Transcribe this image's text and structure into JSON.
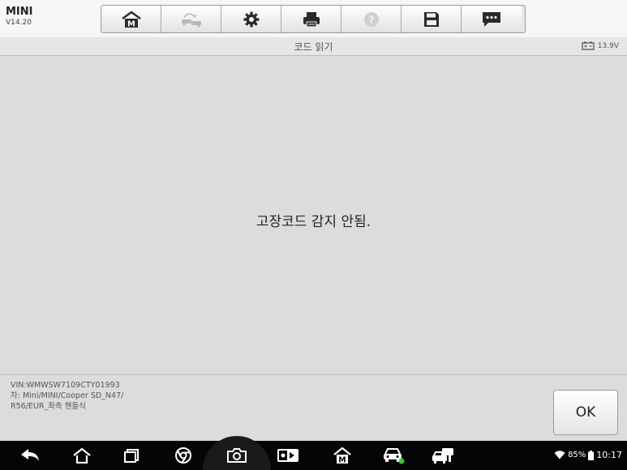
{
  "app": {
    "name": "MINI",
    "version": "V14.20"
  },
  "toolbar": {
    "buttons": [
      {
        "icon": "home-m-icon",
        "enabled": true
      },
      {
        "icon": "vehicle-swap-icon",
        "enabled": false
      },
      {
        "icon": "gear-icon",
        "enabled": true
      },
      {
        "icon": "printer-icon",
        "enabled": true
      },
      {
        "icon": "help-icon",
        "enabled": false
      },
      {
        "icon": "save-icon",
        "enabled": true
      },
      {
        "icon": "message-icon",
        "enabled": true
      }
    ]
  },
  "titlebar": {
    "title": "코드 읽기",
    "battery_voltage": "13.9V"
  },
  "main": {
    "message": "고장코드 감지 안됨."
  },
  "footer": {
    "vin": "VIN:WMWSW7109CTY01993",
    "vehicle_line1": "차: Mini/MINI/Cooper SD_N47/",
    "vehicle_line2": "R56/EUR_좌측 핸들식",
    "ok_label": "OK"
  },
  "navbar": {
    "icons": [
      "back-icon",
      "home-icon",
      "recent-apps-icon",
      "browser-icon",
      "camera-icon",
      "screen-record-icon",
      "maxisys-m-icon",
      "vehicle-connect-icon",
      "vci-icon"
    ]
  },
  "status": {
    "battery_percent": "85%",
    "time": "10:17"
  },
  "colors": {
    "accent": "#2a2a2a",
    "background": "#dcdcdc",
    "navbar": "#050505",
    "connected": "#3cc83c"
  }
}
